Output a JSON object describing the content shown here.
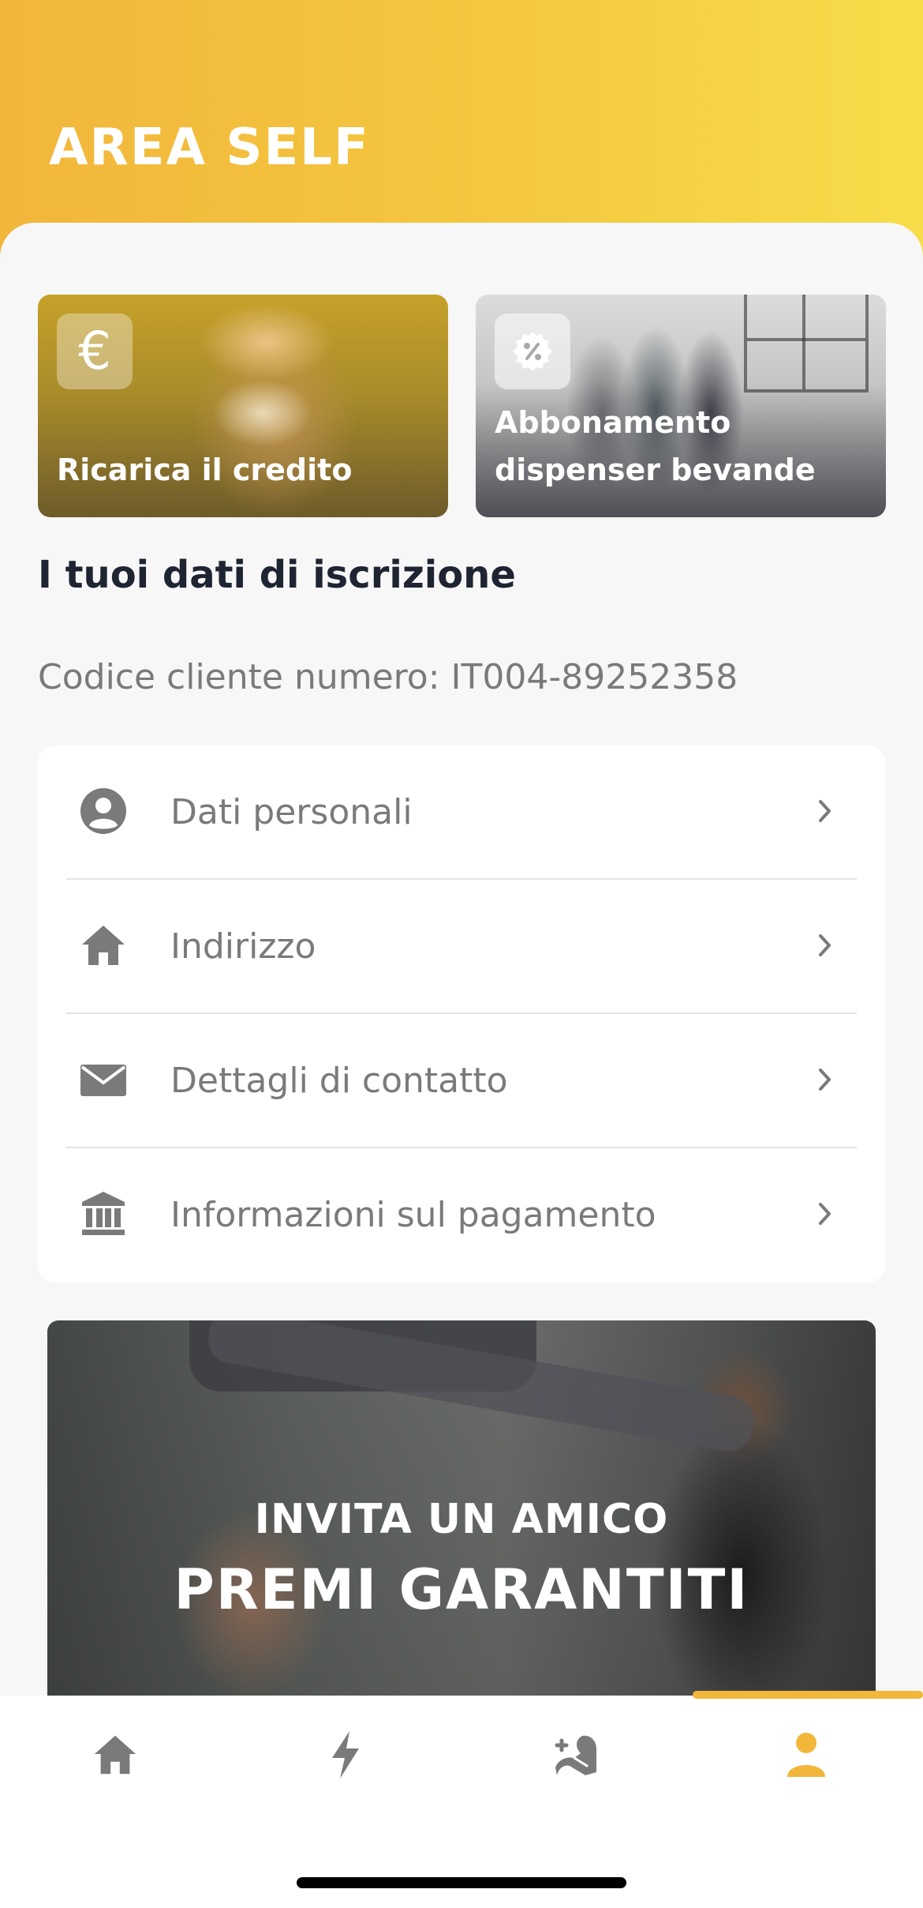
{
  "header": {
    "title": "AREA SELF"
  },
  "cards": [
    {
      "label": "Ricarica il credito",
      "icon": "euro-icon"
    },
    {
      "label": "Abbonamento dispenser bevande",
      "icon": "discount-badge-icon"
    }
  ],
  "registration": {
    "section_title": "I tuoi dati di iscrizione",
    "client_code_prefix": "Codice cliente numero:",
    "client_code": "IT004-89252358"
  },
  "menu": {
    "items": [
      {
        "label": "Dati personali",
        "icon": "person-icon"
      },
      {
        "label": "Indirizzo",
        "icon": "home-icon"
      },
      {
        "label": "Dettagli di contatto",
        "icon": "envelope-icon"
      },
      {
        "label": "Informazioni sul pagamento",
        "icon": "bank-icon"
      }
    ]
  },
  "promo": {
    "subtitle": "INVITA UN AMICO",
    "title": "PREMI GARANTITI"
  },
  "tabbar": {
    "tabs": [
      {
        "icon": "home-icon",
        "active": false
      },
      {
        "icon": "lightning-icon",
        "active": false
      },
      {
        "icon": "muscle-plus-icon",
        "active": false
      },
      {
        "icon": "person-icon",
        "active": true
      }
    ],
    "active_color": "#f2b63b",
    "inactive_color": "#7a7a7a"
  },
  "colors": {
    "accent": "#f2b63b",
    "title_text": "#1f2433",
    "muted_text": "#7a7a7a"
  }
}
